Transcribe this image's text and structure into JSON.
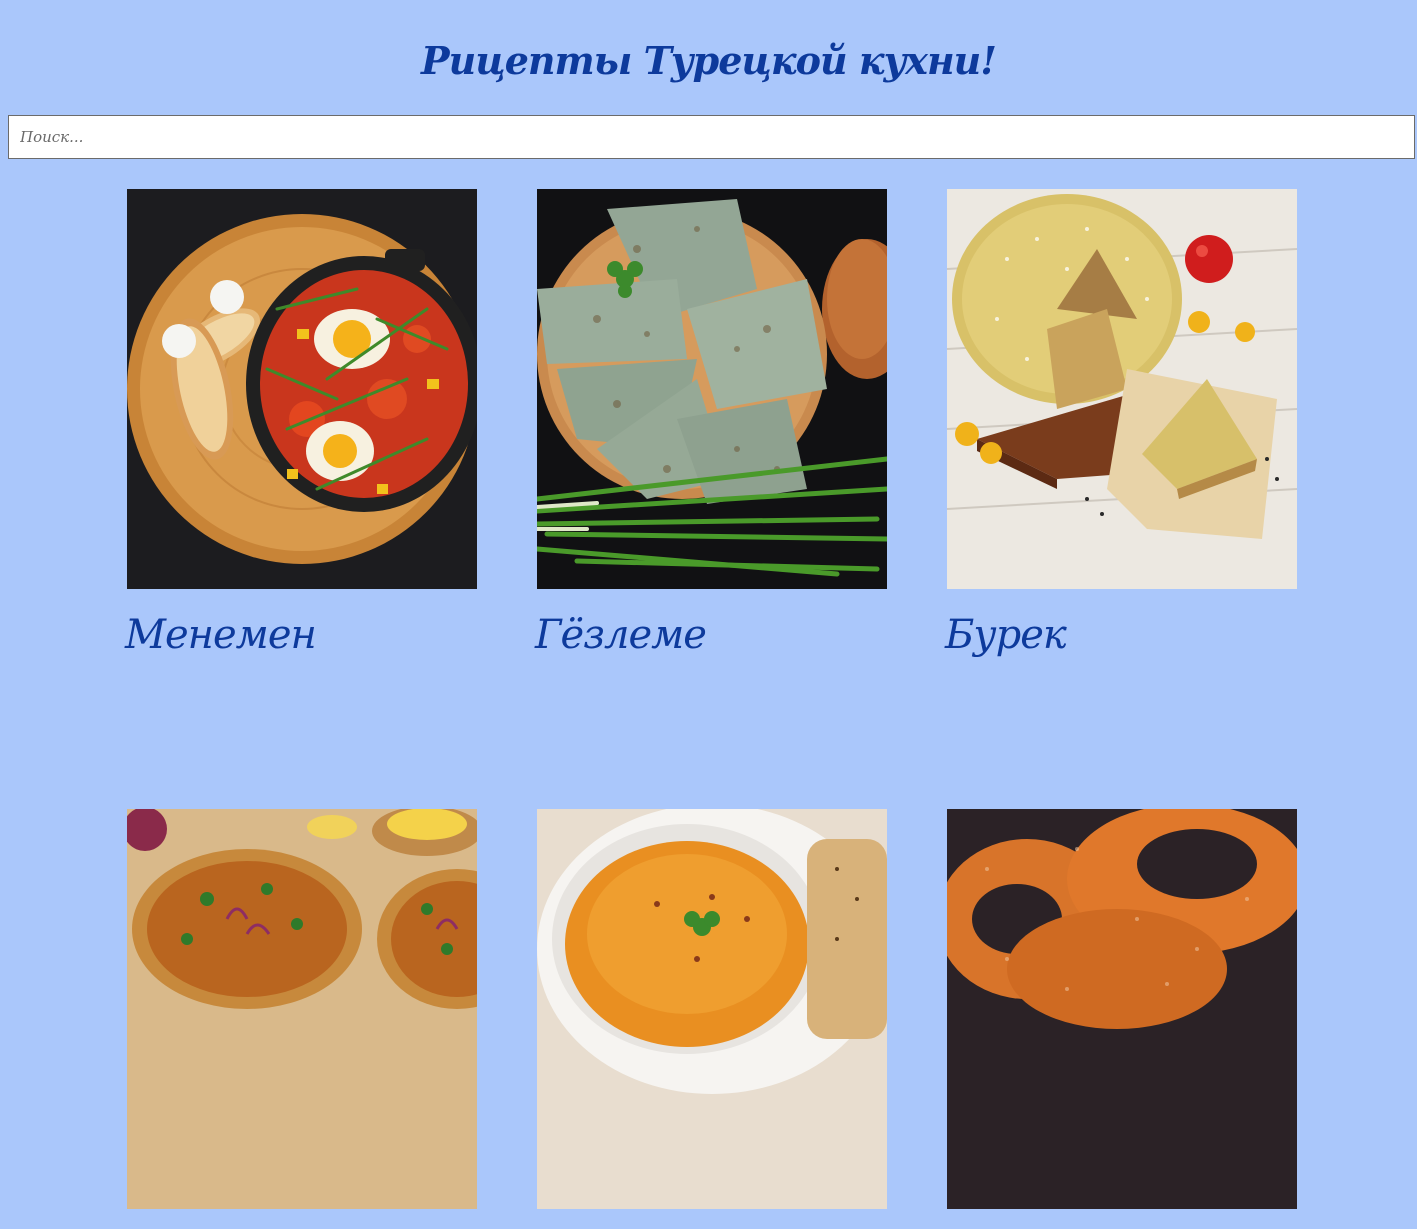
{
  "header": {
    "title": "Рицепты Турецкой кухни!"
  },
  "search": {
    "placeholder": "Поиск...",
    "value": ""
  },
  "recipes": [
    {
      "title": "Менемен",
      "image": "menemen-photo"
    },
    {
      "title": "Гёзлеме",
      "image": "gozleme-photo"
    },
    {
      "title": "Бурек",
      "image": "burek-photo"
    },
    {
      "title": "",
      "image": "lahmacun-photo"
    },
    {
      "title": "",
      "image": "lentil-soup-photo"
    },
    {
      "title": "",
      "image": "simit-photo"
    }
  ],
  "colors": {
    "background": "#aac7fb",
    "accent": "#0d3a9c"
  }
}
